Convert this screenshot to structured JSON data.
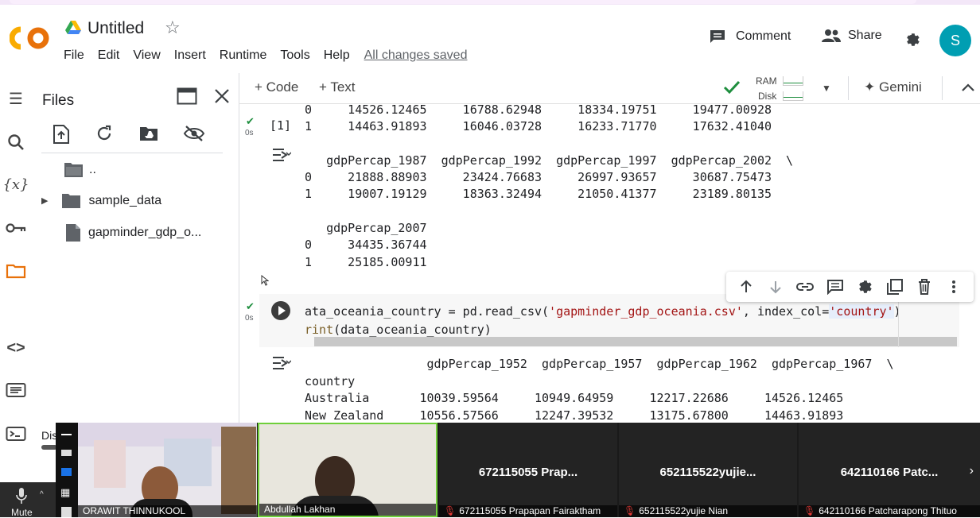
{
  "app": {
    "title": "Untitled",
    "menu": [
      "File",
      "Edit",
      "View",
      "Insert",
      "Runtime",
      "Tools",
      "Help"
    ],
    "saved_status": "All changes saved",
    "comment_label": "Comment",
    "share_label": "Share",
    "avatar_letter": "S"
  },
  "toolbar": {
    "code_label": "+ Code",
    "text_label": "+ Text",
    "ram_label": "RAM",
    "disk_label": "Disk",
    "gemini_label": "Gemini"
  },
  "files": {
    "title": "Files",
    "items": [
      {
        "label": ".."
      },
      {
        "label": "sample_data"
      },
      {
        "label": "gapminder_gdp_o..."
      }
    ]
  },
  "output1": {
    "lines": [
      "0     14526.12465     16788.62948     18334.19751     19477.00928",
      "1     14463.91893     16046.03728     16233.71770     17632.41040",
      "",
      "   gdpPercap_1987  gdpPercap_1992  gdpPercap_1997  gdpPercap_2002  \\",
      "0     21888.88903     23424.76683     26997.93657     30687.75473",
      "1     19007.19129     18363.32494     21050.41377     23189.80135",
      "",
      "   gdpPercap_2007",
      "0     34435.36744",
      "1     25185.00911"
    ],
    "exec_count": "[1]",
    "time": "0s"
  },
  "cell2": {
    "time": "0s",
    "code_line1_a": "ata_oceania_country = pd.read_csv(",
    "code_line1_str": "'gapminder_gdp_oceania.csv'",
    "code_line1_b": ", index_col=",
    "code_line1_str2": "'country'",
    "code_line1_c": ")",
    "code_line2_fn": "rint",
    "code_line2_b": "(data_oceania_country)"
  },
  "output2": {
    "lines": [
      "                 gdpPercap_1952  gdpPercap_1957  gdpPercap_1962  gdpPercap_1967  \\",
      "country",
      "Australia       10039.59564     10949.64959     12217.22686     14526.12465",
      "New Zealand     10556.57566     12247.39532     13175.67800     14463.91893"
    ]
  },
  "meeting": {
    "mute_label": "Mute",
    "tiles": [
      {
        "caption": "ORAWIT THINNUKOOL"
      },
      {
        "caption": "Abdullah Lakhan"
      },
      {
        "big": "672115055 Prap...",
        "caption": "672115055 Prapapan Fairaktham"
      },
      {
        "big": "652115522yujie...",
        "caption": "652115522yujie Nian"
      },
      {
        "big": "642110166 Patc...",
        "caption": "642110166 Patcharapong Thituo"
      }
    ],
    "side_label": "Dis"
  }
}
